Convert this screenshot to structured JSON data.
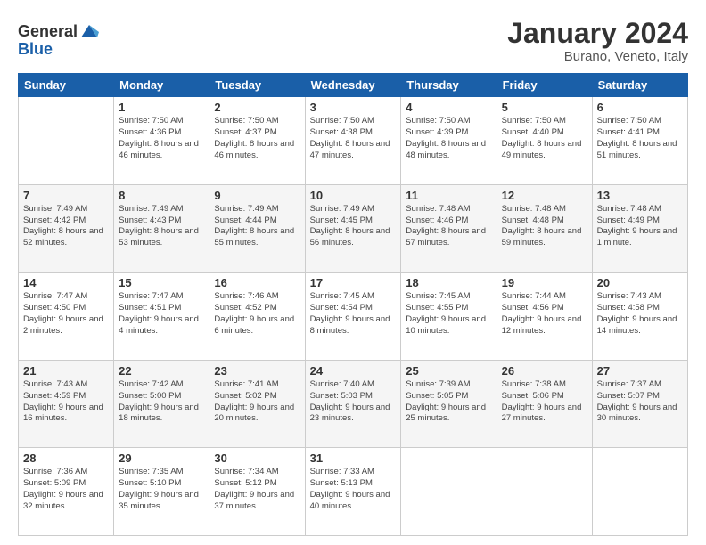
{
  "header": {
    "logo": {
      "general": "General",
      "blue": "Blue"
    },
    "title": "January 2024",
    "subtitle": "Burano, Veneto, Italy"
  },
  "weekdays": [
    "Sunday",
    "Monday",
    "Tuesday",
    "Wednesday",
    "Thursday",
    "Friday",
    "Saturday"
  ],
  "weeks": [
    [
      {
        "day": "",
        "sunrise": "",
        "sunset": "",
        "daylight": ""
      },
      {
        "day": "1",
        "sunrise": "Sunrise: 7:50 AM",
        "sunset": "Sunset: 4:36 PM",
        "daylight": "Daylight: 8 hours and 46 minutes."
      },
      {
        "day": "2",
        "sunrise": "Sunrise: 7:50 AM",
        "sunset": "Sunset: 4:37 PM",
        "daylight": "Daylight: 8 hours and 46 minutes."
      },
      {
        "day": "3",
        "sunrise": "Sunrise: 7:50 AM",
        "sunset": "Sunset: 4:38 PM",
        "daylight": "Daylight: 8 hours and 47 minutes."
      },
      {
        "day": "4",
        "sunrise": "Sunrise: 7:50 AM",
        "sunset": "Sunset: 4:39 PM",
        "daylight": "Daylight: 8 hours and 48 minutes."
      },
      {
        "day": "5",
        "sunrise": "Sunrise: 7:50 AM",
        "sunset": "Sunset: 4:40 PM",
        "daylight": "Daylight: 8 hours and 49 minutes."
      },
      {
        "day": "6",
        "sunrise": "Sunrise: 7:50 AM",
        "sunset": "Sunset: 4:41 PM",
        "daylight": "Daylight: 8 hours and 51 minutes."
      }
    ],
    [
      {
        "day": "7",
        "sunrise": "Sunrise: 7:49 AM",
        "sunset": "Sunset: 4:42 PM",
        "daylight": "Daylight: 8 hours and 52 minutes."
      },
      {
        "day": "8",
        "sunrise": "Sunrise: 7:49 AM",
        "sunset": "Sunset: 4:43 PM",
        "daylight": "Daylight: 8 hours and 53 minutes."
      },
      {
        "day": "9",
        "sunrise": "Sunrise: 7:49 AM",
        "sunset": "Sunset: 4:44 PM",
        "daylight": "Daylight: 8 hours and 55 minutes."
      },
      {
        "day": "10",
        "sunrise": "Sunrise: 7:49 AM",
        "sunset": "Sunset: 4:45 PM",
        "daylight": "Daylight: 8 hours and 56 minutes."
      },
      {
        "day": "11",
        "sunrise": "Sunrise: 7:48 AM",
        "sunset": "Sunset: 4:46 PM",
        "daylight": "Daylight: 8 hours and 57 minutes."
      },
      {
        "day": "12",
        "sunrise": "Sunrise: 7:48 AM",
        "sunset": "Sunset: 4:48 PM",
        "daylight": "Daylight: 8 hours and 59 minutes."
      },
      {
        "day": "13",
        "sunrise": "Sunrise: 7:48 AM",
        "sunset": "Sunset: 4:49 PM",
        "daylight": "Daylight: 9 hours and 1 minute."
      }
    ],
    [
      {
        "day": "14",
        "sunrise": "Sunrise: 7:47 AM",
        "sunset": "Sunset: 4:50 PM",
        "daylight": "Daylight: 9 hours and 2 minutes."
      },
      {
        "day": "15",
        "sunrise": "Sunrise: 7:47 AM",
        "sunset": "Sunset: 4:51 PM",
        "daylight": "Daylight: 9 hours and 4 minutes."
      },
      {
        "day": "16",
        "sunrise": "Sunrise: 7:46 AM",
        "sunset": "Sunset: 4:52 PM",
        "daylight": "Daylight: 9 hours and 6 minutes."
      },
      {
        "day": "17",
        "sunrise": "Sunrise: 7:45 AM",
        "sunset": "Sunset: 4:54 PM",
        "daylight": "Daylight: 9 hours and 8 minutes."
      },
      {
        "day": "18",
        "sunrise": "Sunrise: 7:45 AM",
        "sunset": "Sunset: 4:55 PM",
        "daylight": "Daylight: 9 hours and 10 minutes."
      },
      {
        "day": "19",
        "sunrise": "Sunrise: 7:44 AM",
        "sunset": "Sunset: 4:56 PM",
        "daylight": "Daylight: 9 hours and 12 minutes."
      },
      {
        "day": "20",
        "sunrise": "Sunrise: 7:43 AM",
        "sunset": "Sunset: 4:58 PM",
        "daylight": "Daylight: 9 hours and 14 minutes."
      }
    ],
    [
      {
        "day": "21",
        "sunrise": "Sunrise: 7:43 AM",
        "sunset": "Sunset: 4:59 PM",
        "daylight": "Daylight: 9 hours and 16 minutes."
      },
      {
        "day": "22",
        "sunrise": "Sunrise: 7:42 AM",
        "sunset": "Sunset: 5:00 PM",
        "daylight": "Daylight: 9 hours and 18 minutes."
      },
      {
        "day": "23",
        "sunrise": "Sunrise: 7:41 AM",
        "sunset": "Sunset: 5:02 PM",
        "daylight": "Daylight: 9 hours and 20 minutes."
      },
      {
        "day": "24",
        "sunrise": "Sunrise: 7:40 AM",
        "sunset": "Sunset: 5:03 PM",
        "daylight": "Daylight: 9 hours and 23 minutes."
      },
      {
        "day": "25",
        "sunrise": "Sunrise: 7:39 AM",
        "sunset": "Sunset: 5:05 PM",
        "daylight": "Daylight: 9 hours and 25 minutes."
      },
      {
        "day": "26",
        "sunrise": "Sunrise: 7:38 AM",
        "sunset": "Sunset: 5:06 PM",
        "daylight": "Daylight: 9 hours and 27 minutes."
      },
      {
        "day": "27",
        "sunrise": "Sunrise: 7:37 AM",
        "sunset": "Sunset: 5:07 PM",
        "daylight": "Daylight: 9 hours and 30 minutes."
      }
    ],
    [
      {
        "day": "28",
        "sunrise": "Sunrise: 7:36 AM",
        "sunset": "Sunset: 5:09 PM",
        "daylight": "Daylight: 9 hours and 32 minutes."
      },
      {
        "day": "29",
        "sunrise": "Sunrise: 7:35 AM",
        "sunset": "Sunset: 5:10 PM",
        "daylight": "Daylight: 9 hours and 35 minutes."
      },
      {
        "day": "30",
        "sunrise": "Sunrise: 7:34 AM",
        "sunset": "Sunset: 5:12 PM",
        "daylight": "Daylight: 9 hours and 37 minutes."
      },
      {
        "day": "31",
        "sunrise": "Sunrise: 7:33 AM",
        "sunset": "Sunset: 5:13 PM",
        "daylight": "Daylight: 9 hours and 40 minutes."
      },
      {
        "day": "",
        "sunrise": "",
        "sunset": "",
        "daylight": ""
      },
      {
        "day": "",
        "sunrise": "",
        "sunset": "",
        "daylight": ""
      },
      {
        "day": "",
        "sunrise": "",
        "sunset": "",
        "daylight": ""
      }
    ]
  ]
}
